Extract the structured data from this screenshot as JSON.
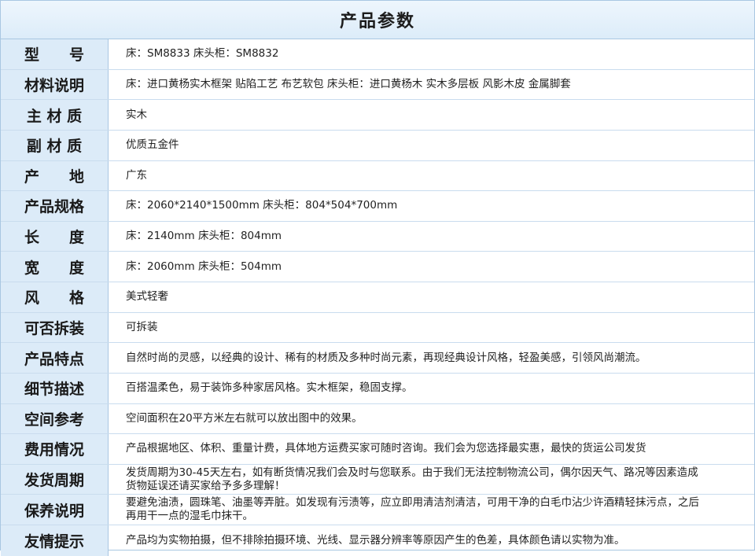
{
  "header": {
    "title": "产品参数"
  },
  "rows": [
    {
      "label": "型　　号",
      "value": "床：SM8833  床头柜：SM8832"
    },
    {
      "label": "材料说明",
      "value": "床：进口黄杨实木框架  贴陷工艺 布艺软包   床头柜：进口黄杨木 实木多层板 风影木皮  金属脚套"
    },
    {
      "label": "主 材 质",
      "value": "实木"
    },
    {
      "label": "副 材 质",
      "value": "优质五金件"
    },
    {
      "label": "产　　地",
      "value": "广东"
    },
    {
      "label": "产品规格",
      "value": "床：2060*2140*1500mm   床头柜：804*504*700mm"
    },
    {
      "label": "长　　度",
      "value": "床：2140mm   床头柜：804mm"
    },
    {
      "label": "宽　　度",
      "value": "床：2060mm   床头柜：504mm"
    },
    {
      "label": "风　　格",
      "value": "美式轻奢"
    },
    {
      "label": "可否拆装",
      "value": "可拆装"
    },
    {
      "label": "产品特点",
      "value": "自然时尚的灵感，以经典的设计、稀有的材质及多种时尚元素，再现经典设计风格，轻盈美感，引领风尚潮流。"
    },
    {
      "label": "细节描述",
      "value": "百搭温柔色，易于装饰多种家居风格。实木框架，稳固支撑。"
    },
    {
      "label": "空间参考",
      "value": "空间面积在20平方米左右就可以放出图中的效果。"
    },
    {
      "label": "费用情况",
      "value": "产品根据地区、体积、重量计费，具体地方运费买家可随时咨询。我们会为您选择最实惠，最快的货运公司发货"
    },
    {
      "label": "发货周期",
      "value": "发货周期为30-45天左右，如有断货情况我们会及时与您联系。由于我们无法控制物流公司，偶尔因天气、路况等因素造成货物延误还请买家给予多多理解！"
    },
    {
      "label": "保养说明",
      "value": "要避免油渍，圆珠笔、油墨等弄脏。如发现有污渍等，应立即用清洁剂清洁，可用干净的白毛巾沾少许酒精轻抹污点，之后再用干一点的湿毛巾抹干。"
    },
    {
      "label": "友情提示",
      "value": "产品均为实物拍摄，但不排除拍摄环境、光线、显示器分辨率等原因产生的色差，具体颜色请以实物为准。"
    }
  ]
}
